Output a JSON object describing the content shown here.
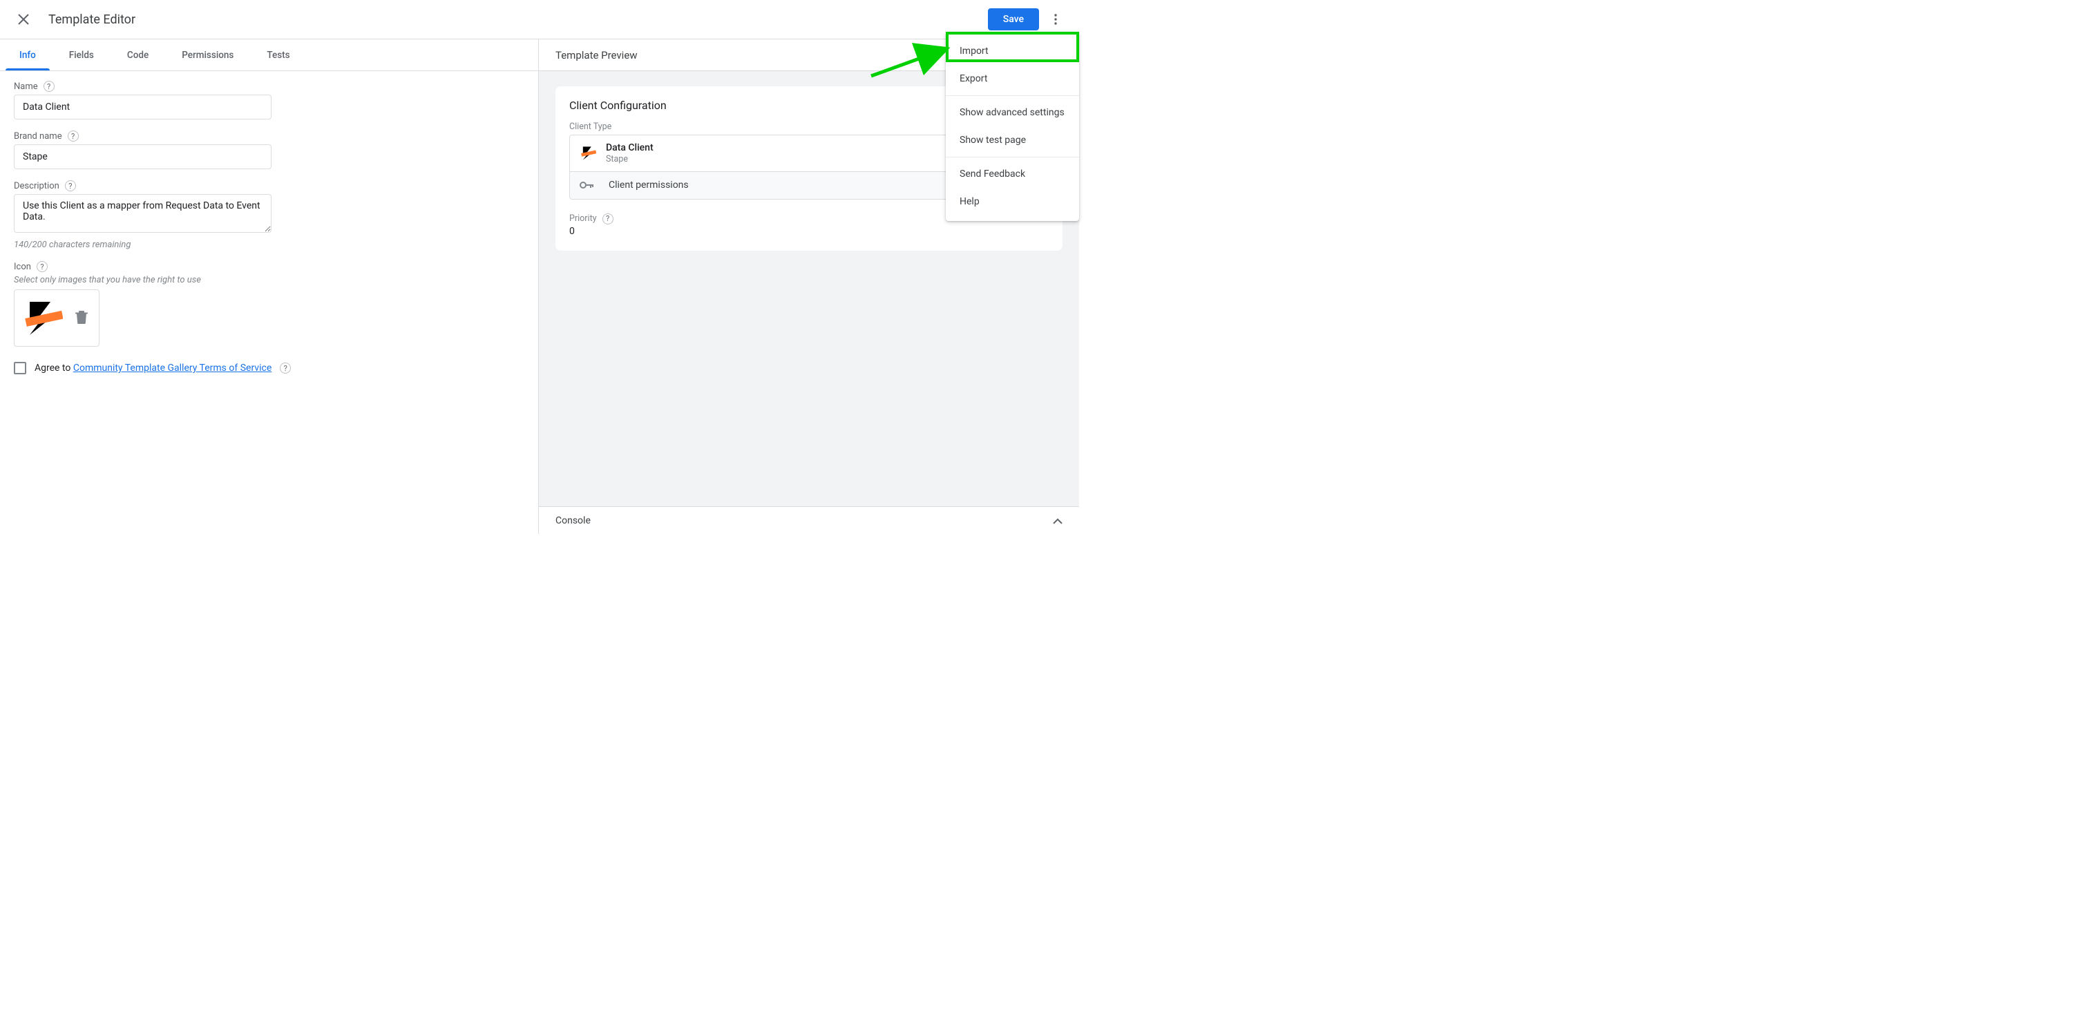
{
  "header": {
    "title": "Template Editor",
    "save_label": "Save"
  },
  "tabs": [
    {
      "label": "Info",
      "active": true
    },
    {
      "label": "Fields"
    },
    {
      "label": "Code"
    },
    {
      "label": "Permissions"
    },
    {
      "label": "Tests"
    }
  ],
  "form": {
    "name": {
      "label": "Name",
      "value": "Data Client"
    },
    "brand": {
      "label": "Brand name",
      "value": "Stape"
    },
    "description": {
      "label": "Description",
      "value": "Use this Client as a mapper from Request Data to Event Data.",
      "counter": "140/200 characters remaining"
    },
    "icon": {
      "label": "Icon",
      "hint": "Select only images that you have the right to use"
    },
    "agree": {
      "prefix": "Agree to ",
      "link": "Community Template Gallery Terms of Service"
    }
  },
  "preview": {
    "title": "Template Preview",
    "card_title": "Client Configuration",
    "client_type_label": "Client Type",
    "client_name": "Data Client",
    "client_brand": "Stape",
    "permissions_label": "Client permissions",
    "priority_label": "Priority",
    "priority_value": "0",
    "console_label": "Console"
  },
  "menu": {
    "import": "Import",
    "export": "Export",
    "advanced": "Show advanced settings",
    "testpage": "Show test page",
    "feedback": "Send Feedback",
    "help": "Help"
  }
}
